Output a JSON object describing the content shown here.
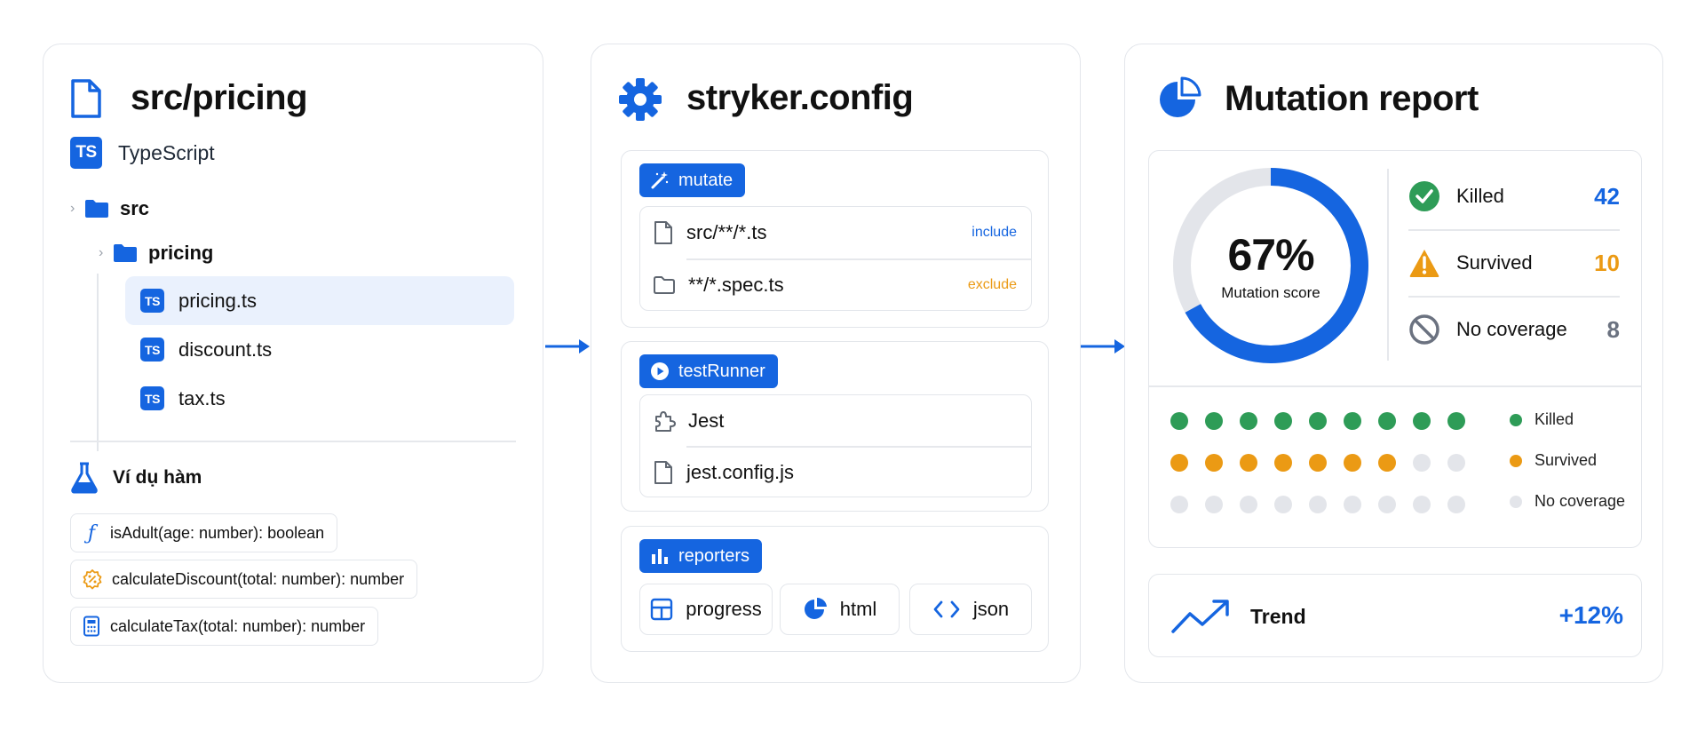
{
  "colors": {
    "accent": "#1565e0",
    "success": "#2e9c57",
    "warning": "#eb9a14",
    "muted": "#e3e5ea",
    "neutral": "#6b7280"
  },
  "files_panel": {
    "title": "src/pricing",
    "language_badge": "TS",
    "language": "TypeScript",
    "tree": {
      "root_folder": "src",
      "sub_folder": "pricing",
      "files": [
        {
          "badge": "TS",
          "name": "pricing.ts",
          "selected": true
        },
        {
          "badge": "TS",
          "name": "discount.ts",
          "selected": false
        },
        {
          "badge": "TS",
          "name": "tax.ts",
          "selected": false
        }
      ]
    },
    "examples": {
      "title": "Ví dụ hàm",
      "functions": [
        {
          "icon": "function-icon",
          "signature": "isAdult(age: number): boolean"
        },
        {
          "icon": "discount-icon",
          "signature": "calculateDiscount(total: number): number"
        },
        {
          "icon": "calculator-icon",
          "signature": "calculateTax(total: number): number"
        }
      ]
    }
  },
  "config_panel": {
    "title": "stryker.config",
    "mutate": {
      "label": "mutate",
      "rows": [
        {
          "icon": "file-icon",
          "pattern": "src/**/*.ts",
          "tag": "include"
        },
        {
          "icon": "folder-icon",
          "pattern": "**/*.spec.ts",
          "tag": "exclude"
        }
      ]
    },
    "test_runner": {
      "label": "testRunner",
      "rows": [
        {
          "icon": "puzzle-icon",
          "value": "Jest"
        },
        {
          "icon": "file-icon",
          "value": "jest.config.js"
        }
      ]
    },
    "reporters": {
      "label": "reporters",
      "items": [
        {
          "icon": "table-icon",
          "label": "progress"
        },
        {
          "icon": "pie-icon",
          "label": "html"
        },
        {
          "icon": "code-icon",
          "label": "json"
        }
      ]
    }
  },
  "report_panel": {
    "title": "Mutation report",
    "score": {
      "value": 0.67,
      "display": "67%",
      "label": "Mutation score"
    },
    "stats": [
      {
        "key": "killed",
        "label": "Killed",
        "value": "42"
      },
      {
        "key": "survived",
        "label": "Survived",
        "value": "10"
      },
      {
        "key": "nocov",
        "label": "No coverage",
        "value": "8"
      }
    ],
    "dot_grid": {
      "rows": [
        {
          "filled": 9,
          "total": 9
        },
        {
          "filled": 7,
          "total": 9
        },
        {
          "filled": 0,
          "total": 9
        }
      ]
    },
    "legend": [
      "Killed",
      "Survived",
      "No coverage"
    ],
    "trend": {
      "label": "Trend",
      "value": "+12%"
    }
  }
}
